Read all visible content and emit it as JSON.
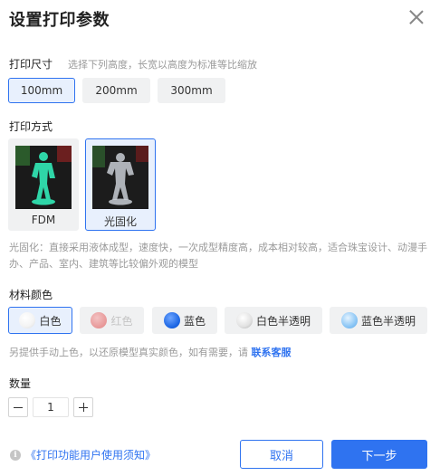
{
  "dialog": {
    "title": "设置打印参数"
  },
  "size": {
    "label": "打印尺寸",
    "hint": "选择下列高度，长宽以高度为标准等比缩放",
    "options": [
      "100mm",
      "200mm",
      "300mm"
    ],
    "selected": "100mm"
  },
  "method": {
    "label": "打印方式",
    "options": [
      {
        "label": "FDM",
        "color": "#2fd6a8"
      },
      {
        "label": "光固化",
        "color": "#c8ccd4"
      }
    ],
    "selected": "光固化",
    "description": "光固化：直接采用液体成型，速度快，一次成型精度高，成本相对较高，适合珠宝设计、动漫手办、产品、室内、建筑等比较偏外观的模型"
  },
  "material": {
    "label": "材料颜色",
    "options": [
      {
        "label": "白色",
        "color": "#ffffff",
        "disabled": false
      },
      {
        "label": "红色",
        "color": "#e25b5b",
        "disabled": true
      },
      {
        "label": "蓝色",
        "color": "#1c66e4",
        "disabled": false
      },
      {
        "label": "白色半透明",
        "color": "#dcdcdc",
        "disabled": false
      },
      {
        "label": "蓝色半透明",
        "color": "#8cc6f5",
        "disabled": false
      }
    ],
    "selected": "白色",
    "note_prefix": "另提供手动上色，以还原模型真实颜色，如有需要，请",
    "note_link": "联系客服"
  },
  "quantity": {
    "label": "数量",
    "value": "1"
  },
  "footer": {
    "notice": "《打印功能用户使用须知》",
    "cancel": "取消",
    "next": "下一步"
  },
  "colors": {
    "accent": "#2f73f0"
  }
}
